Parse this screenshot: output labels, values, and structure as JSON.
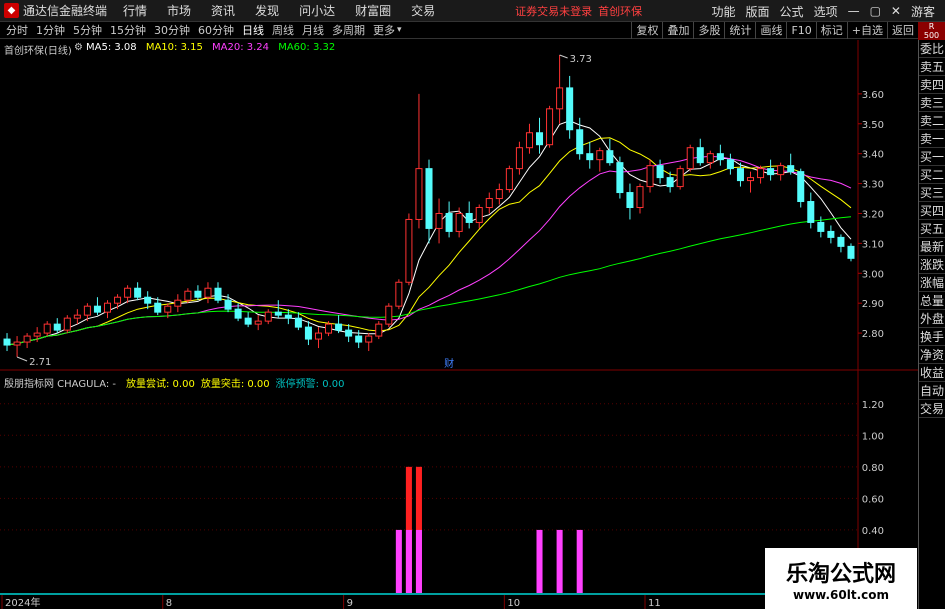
{
  "topbar": {
    "app_title": "通达信金融终端",
    "menus": [
      "行情",
      "市场",
      "资讯",
      "发现",
      "问小达",
      "财富圈",
      "交易"
    ],
    "warning": "证券交易未登录",
    "stock": "首创环保",
    "right": [
      "功能",
      "版面",
      "公式",
      "选项"
    ],
    "guest": "游客"
  },
  "periods": [
    "分时",
    "1分钟",
    "5分钟",
    "15分钟",
    "30分钟",
    "60分钟",
    "日线",
    "周线",
    "月线",
    "多周期",
    "更多"
  ],
  "active_period": "日线",
  "toolbar_right": [
    "复权",
    "叠加",
    "多股",
    "统计",
    "画线",
    "F10",
    "标记",
    "+自选",
    "返回"
  ],
  "right_badge": {
    "top": "R",
    "bottom": "500"
  },
  "sidebar": [
    "委比",
    "卖五",
    "卖四",
    "卖三",
    "卖二",
    "卖一",
    "买一",
    "买二",
    "买三",
    "买四",
    "买五",
    "最新",
    "涨跌",
    "涨幅",
    "总量",
    "外盘",
    "换手",
    "净资",
    "收益"
  ],
  "sidebar_bottom": [
    "自动",
    "交易"
  ],
  "main_title": "首创环保(日线)",
  "ma": [
    {
      "label": "MA5: 3.08",
      "color": "#ffffff"
    },
    {
      "label": "MA10: 3.15",
      "color": "#ffff00"
    },
    {
      "label": "MA20: 3.24",
      "color": "#ff40ff"
    },
    {
      "label": "MA60: 3.32",
      "color": "#00ff00"
    }
  ],
  "sub_title": "殷朋指标网 CHAGULA: -",
  "sub_items": [
    {
      "label": "放量尝试: 0.00",
      "color": "#ffff00"
    },
    {
      "label": "放量突击: 0.00",
      "color": "#ffff00"
    },
    {
      "label": "涨停预警: 0.00",
      "color": "#00c0c0"
    }
  ],
  "price_max_label": "3.73",
  "price_min_label": "2.71",
  "event_mark": "财",
  "watermark": {
    "main": "乐淘公式网",
    "url": "www.60lt.com"
  },
  "chart_data": [
    {
      "type": "candlestick",
      "yaxis": [
        2.8,
        2.9,
        3.0,
        3.1,
        3.2,
        3.3,
        3.4,
        3.5,
        3.6
      ],
      "ylim": [
        2.71,
        3.73
      ],
      "x_labels": [
        "2024年",
        "8",
        "9",
        "10",
        "11",
        "12"
      ],
      "ohlc": [
        [
          2.78,
          2.8,
          2.74,
          2.76
        ],
        [
          2.76,
          2.79,
          2.72,
          2.77
        ],
        [
          2.77,
          2.8,
          2.75,
          2.79
        ],
        [
          2.79,
          2.82,
          2.77,
          2.8
        ],
        [
          2.8,
          2.84,
          2.79,
          2.83
        ],
        [
          2.83,
          2.85,
          2.8,
          2.81
        ],
        [
          2.81,
          2.86,
          2.8,
          2.85
        ],
        [
          2.85,
          2.88,
          2.83,
          2.86
        ],
        [
          2.86,
          2.9,
          2.84,
          2.89
        ],
        [
          2.89,
          2.92,
          2.86,
          2.87
        ],
        [
          2.87,
          2.91,
          2.85,
          2.9
        ],
        [
          2.9,
          2.93,
          2.88,
          2.92
        ],
        [
          2.92,
          2.96,
          2.9,
          2.95
        ],
        [
          2.95,
          2.97,
          2.91,
          2.92
        ],
        [
          2.92,
          2.94,
          2.88,
          2.9
        ],
        [
          2.9,
          2.92,
          2.86,
          2.87
        ],
        [
          2.87,
          2.9,
          2.85,
          2.89
        ],
        [
          2.89,
          2.93,
          2.87,
          2.91
        ],
        [
          2.91,
          2.95,
          2.9,
          2.94
        ],
        [
          2.94,
          2.96,
          2.91,
          2.92
        ],
        [
          2.92,
          2.97,
          2.9,
          2.95
        ],
        [
          2.95,
          2.97,
          2.9,
          2.91
        ],
        [
          2.91,
          2.93,
          2.87,
          2.88
        ],
        [
          2.88,
          2.9,
          2.84,
          2.85
        ],
        [
          2.85,
          2.87,
          2.82,
          2.83
        ],
        [
          2.83,
          2.86,
          2.81,
          2.84
        ],
        [
          2.84,
          2.88,
          2.83,
          2.87
        ],
        [
          2.87,
          2.91,
          2.85,
          2.86
        ],
        [
          2.86,
          2.88,
          2.83,
          2.85
        ],
        [
          2.85,
          2.87,
          2.81,
          2.82
        ],
        [
          2.82,
          2.84,
          2.76,
          2.78
        ],
        [
          2.78,
          2.82,
          2.75,
          2.8
        ],
        [
          2.8,
          2.84,
          2.79,
          2.83
        ],
        [
          2.83,
          2.86,
          2.8,
          2.81
        ],
        [
          2.81,
          2.83,
          2.77,
          2.79
        ],
        [
          2.79,
          2.81,
          2.75,
          2.77
        ],
        [
          2.77,
          2.8,
          2.74,
          2.79
        ],
        [
          2.79,
          2.84,
          2.78,
          2.83
        ],
        [
          2.83,
          2.9,
          2.82,
          2.89
        ],
        [
          2.89,
          2.98,
          2.88,
          2.97
        ],
        [
          2.97,
          3.2,
          2.96,
          3.18
        ],
        [
          3.18,
          3.6,
          3.15,
          3.35
        ],
        [
          3.35,
          3.38,
          3.1,
          3.15
        ],
        [
          3.15,
          3.25,
          3.1,
          3.2
        ],
        [
          3.2,
          3.24,
          3.12,
          3.14
        ],
        [
          3.14,
          3.22,
          3.12,
          3.2
        ],
        [
          3.2,
          3.24,
          3.15,
          3.17
        ],
        [
          3.17,
          3.23,
          3.15,
          3.22
        ],
        [
          3.22,
          3.27,
          3.2,
          3.25
        ],
        [
          3.25,
          3.3,
          3.23,
          3.28
        ],
        [
          3.28,
          3.36,
          3.27,
          3.35
        ],
        [
          3.35,
          3.44,
          3.33,
          3.42
        ],
        [
          3.42,
          3.5,
          3.4,
          3.47
        ],
        [
          3.47,
          3.52,
          3.4,
          3.43
        ],
        [
          3.43,
          3.56,
          3.42,
          3.55
        ],
        [
          3.55,
          3.73,
          3.5,
          3.62
        ],
        [
          3.62,
          3.66,
          3.45,
          3.48
        ],
        [
          3.48,
          3.52,
          3.38,
          3.4
        ],
        [
          3.4,
          3.44,
          3.35,
          3.38
        ],
        [
          3.38,
          3.42,
          3.34,
          3.41
        ],
        [
          3.41,
          3.45,
          3.36,
          3.37
        ],
        [
          3.37,
          3.39,
          3.25,
          3.27
        ],
        [
          3.27,
          3.3,
          3.18,
          3.22
        ],
        [
          3.22,
          3.3,
          3.2,
          3.29
        ],
        [
          3.29,
          3.38,
          3.27,
          3.36
        ],
        [
          3.36,
          3.38,
          3.3,
          3.32
        ],
        [
          3.32,
          3.34,
          3.27,
          3.29
        ],
        [
          3.29,
          3.36,
          3.28,
          3.35
        ],
        [
          3.35,
          3.43,
          3.34,
          3.42
        ],
        [
          3.42,
          3.45,
          3.36,
          3.37
        ],
        [
          3.37,
          3.41,
          3.35,
          3.4
        ],
        [
          3.4,
          3.43,
          3.36,
          3.38
        ],
        [
          3.38,
          3.4,
          3.33,
          3.35
        ],
        [
          3.35,
          3.37,
          3.29,
          3.31
        ],
        [
          3.31,
          3.34,
          3.27,
          3.32
        ],
        [
          3.32,
          3.36,
          3.3,
          3.35
        ],
        [
          3.35,
          3.38,
          3.31,
          3.33
        ],
        [
          3.33,
          3.37,
          3.31,
          3.36
        ],
        [
          3.36,
          3.4,
          3.33,
          3.34
        ],
        [
          3.34,
          3.35,
          3.22,
          3.24
        ],
        [
          3.24,
          3.27,
          3.15,
          3.17
        ],
        [
          3.17,
          3.19,
          3.12,
          3.14
        ],
        [
          3.14,
          3.16,
          3.1,
          3.12
        ],
        [
          3.12,
          3.13,
          3.07,
          3.09
        ],
        [
          3.09,
          3.1,
          3.04,
          3.05
        ]
      ]
    },
    {
      "type": "bar",
      "yaxis": [
        0.4,
        0.6,
        0.8,
        1.0,
        1.2
      ],
      "ylim": [
        0,
        1.3
      ],
      "bars": [
        {
          "i": 39,
          "v": 0.4,
          "c": "#ff40ff"
        },
        {
          "i": 40,
          "v": 0.8,
          "c": "#ff2020"
        },
        {
          "i": 41,
          "v": 0.8,
          "c": "#ff2020"
        },
        {
          "i": 53,
          "v": 0.4,
          "c": "#ff40ff"
        },
        {
          "i": 55,
          "v": 0.4,
          "c": "#ff40ff"
        },
        {
          "i": 57,
          "v": 0.4,
          "c": "#ff40ff"
        }
      ],
      "under_bars": [
        {
          "i": 40,
          "v": 0.4,
          "c": "#ff40ff"
        },
        {
          "i": 41,
          "v": 0.4,
          "c": "#ff40ff"
        }
      ]
    }
  ]
}
